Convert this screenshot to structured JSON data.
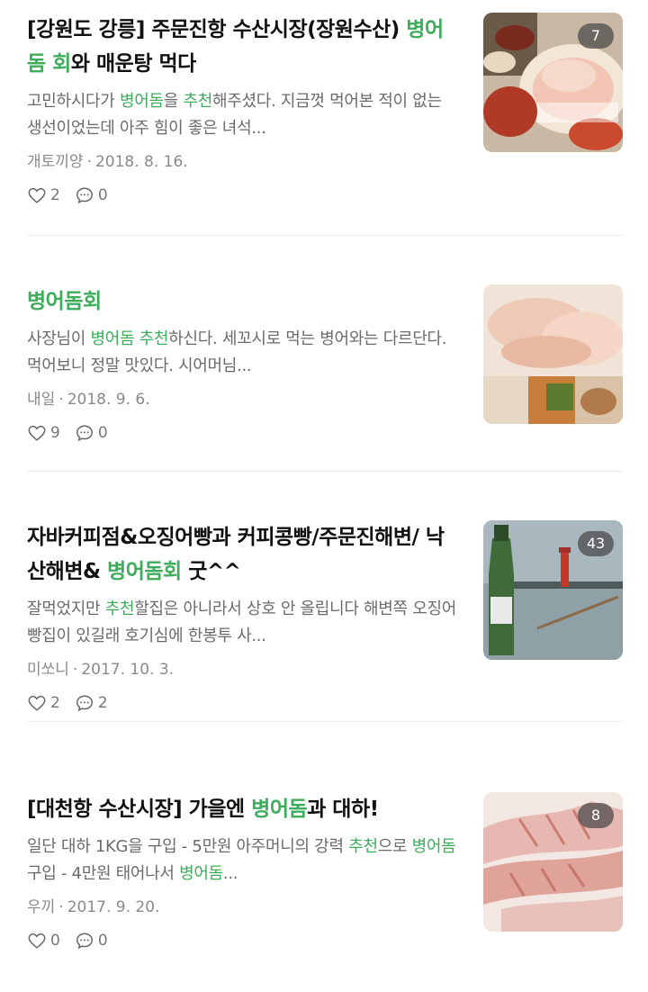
{
  "colors": {
    "highlight": "#3ead5b",
    "text": "#111111",
    "muted": "#6b6b6b",
    "meta": "#8a8a8a"
  },
  "posts": [
    {
      "title_parts": [
        {
          "text": "[강원도 강릉] 주문진항 수산시장(장원수산) ",
          "hl": false
        },
        {
          "text": "병어돔 회",
          "hl": true
        },
        {
          "text": "와 매운탕 먹다",
          "hl": false
        }
      ],
      "snippet_parts": [
        {
          "text": "고민하시다가 ",
          "hl": false
        },
        {
          "text": "병어돔",
          "hl": true
        },
        {
          "text": "을 ",
          "hl": false
        },
        {
          "text": "추천",
          "hl": true
        },
        {
          "text": "해주셨다. 지금껏 먹어본 적이 없는 생선이었는데 아주 힘이 좋은 녀석...",
          "hl": false
        }
      ],
      "author": "개토끼양",
      "date": "2018. 8. 16.",
      "likes": "2",
      "comments": "0",
      "photo_count": "7",
      "thumb_icon": "sashimi-platter-photo"
    },
    {
      "title_parts": [
        {
          "text": "병어돔회",
          "hl": true
        }
      ],
      "snippet_parts": [
        {
          "text": "사장님이 ",
          "hl": false
        },
        {
          "text": "병어돔",
          "hl": true
        },
        {
          "text": " ",
          "hl": false
        },
        {
          "text": "추천",
          "hl": true
        },
        {
          "text": "하신다. 세꼬시로 먹는 병어와는 다르단다. 먹어보니 정말 맛있다. 시어머님...",
          "hl": false
        }
      ],
      "author": "내일",
      "date": "2018. 9. 6.",
      "likes": "9",
      "comments": "0",
      "photo_count": "",
      "thumb_icon": "sliced-fish-photo"
    },
    {
      "title_parts": [
        {
          "text": "자바커피점&오징어빵과 커피콩빵/주문진해변/ 낙산해변& ",
          "hl": false
        },
        {
          "text": "병어돔회",
          "hl": true
        },
        {
          "text": " 굿^^",
          "hl": false
        }
      ],
      "snippet_parts": [
        {
          "text": "잘먹었지만 ",
          "hl": false
        },
        {
          "text": "추천",
          "hl": true
        },
        {
          "text": "할집은 아니라서 상호 안 올립니다 해변쪽 오징어빵집이 있길래 호기심에 한봉투 사...",
          "hl": false
        }
      ],
      "author": "미쏘니",
      "date": "2017. 10. 3.",
      "likes": "2",
      "comments": "2",
      "photo_count": "43",
      "thumb_icon": "harbor-lighthouse-photo"
    },
    {
      "title_parts": [
        {
          "text": "[대천항 수산시장] 가을엔 ",
          "hl": false
        },
        {
          "text": "병어돔",
          "hl": true
        },
        {
          "text": "과 대하!",
          "hl": false
        }
      ],
      "snippet_parts": [
        {
          "text": "일단 대하 1KG을 구입 - 5만원 아주머니의 강력 ",
          "hl": false
        },
        {
          "text": "추천",
          "hl": true
        },
        {
          "text": "으로 ",
          "hl": false
        },
        {
          "text": "병어돔",
          "hl": true
        },
        {
          "text": " 구입 - 4만원 태어나서 ",
          "hl": false
        },
        {
          "text": "병어돔",
          "hl": true
        },
        {
          "text": "...",
          "hl": false
        }
      ],
      "author": "우끼",
      "date": "2017. 9. 20.",
      "likes": "0",
      "comments": "0",
      "photo_count": "8",
      "thumb_icon": "raw-fish-slices-photo"
    }
  ]
}
